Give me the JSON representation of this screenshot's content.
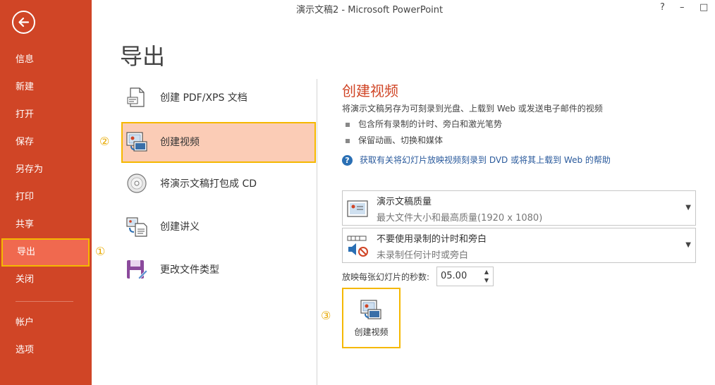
{
  "window": {
    "title": "演示文稿2 - Microsoft PowerPoint",
    "help": "?",
    "minimize": "–",
    "maximize": "□"
  },
  "sidebar": {
    "items": [
      {
        "label": "信息"
      },
      {
        "label": "新建"
      },
      {
        "label": "打开"
      },
      {
        "label": "保存"
      },
      {
        "label": "另存为"
      },
      {
        "label": "打印"
      },
      {
        "label": "共享"
      },
      {
        "label": "导出",
        "active": true
      },
      {
        "label": "关闭"
      },
      {
        "label": "帐户"
      },
      {
        "label": "选项"
      }
    ]
  },
  "page": {
    "title": "导出"
  },
  "export_options": [
    {
      "label": "创建 PDF/XPS 文档",
      "icon": "pdf-document-icon"
    },
    {
      "label": "创建视频",
      "icon": "video-icon",
      "selected": true
    },
    {
      "label": "将演示文稿打包成 CD",
      "icon": "cd-icon"
    },
    {
      "label": "创建讲义",
      "icon": "handout-icon"
    },
    {
      "label": "更改文件类型",
      "icon": "file-type-icon"
    }
  ],
  "annotations": {
    "one": "①",
    "two": "②",
    "three": "③"
  },
  "detail": {
    "title": "创建视频",
    "description": "将演示文稿另存为可刻录到光盘、上载到 Web 或发送电子邮件的视频",
    "bullets": [
      "包含所有录制的计时、旁白和激光笔势",
      "保留动画、切换和媒体"
    ],
    "help_link": "获取有关将幻灯片放映视频刻录到 DVD 或将其上载到 Web 的帮助",
    "quality": {
      "main": "演示文稿质量",
      "sub": "最大文件大小和最高质量(1920 x 1080)"
    },
    "timing": {
      "main": "不要使用录制的计时和旁白",
      "sub": "未录制任何计时或旁白"
    },
    "seconds_label": "放映每张幻灯片的秒数:",
    "seconds_value": "05.00",
    "create_button": "创建视频"
  },
  "colors": {
    "accent": "#d04526",
    "highlight": "#f5b800",
    "selected_bg": "#fbccb6",
    "active_nav": "#f0694f"
  }
}
